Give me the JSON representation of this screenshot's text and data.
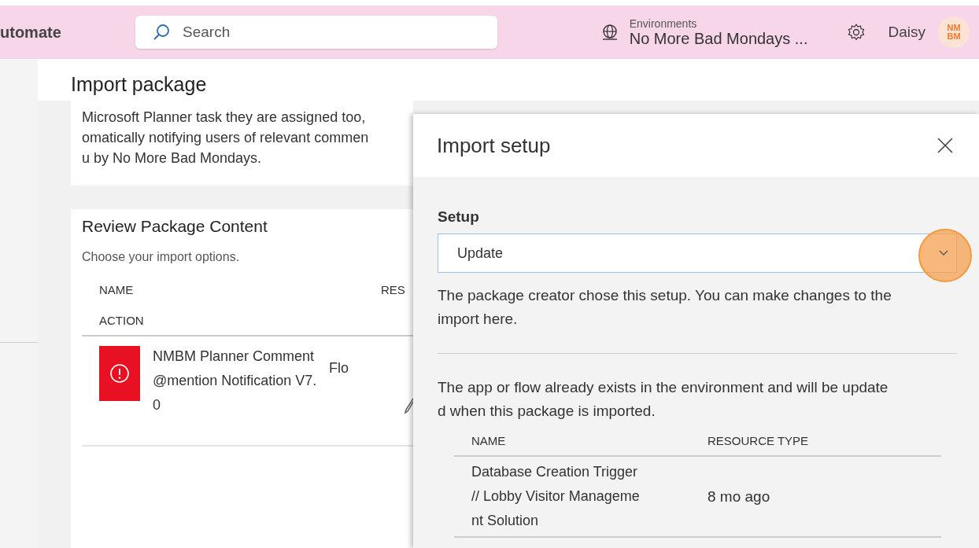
{
  "header": {
    "app_name": "utomate",
    "search": {
      "placeholder": "Search"
    },
    "environment": {
      "label": "Environments",
      "value": "No More Bad Mondays ..."
    },
    "user": {
      "name": "Daisy",
      "avatar": "NMBM"
    }
  },
  "page": {
    "title": "Import package",
    "description_lines": [
      "Microsoft Planner task they are assigned too,",
      "omatically notifying users of relevant commen",
      "u by No More Bad Mondays."
    ],
    "review": {
      "title": "Review Package Content",
      "subtitle": "Choose your import options.",
      "columns": [
        "NAME",
        "RES",
        "ACTION"
      ],
      "rows": [
        {
          "name": "NMBM Planner Comment @mention Notification V7.0",
          "type": "Flo",
          "kind": "error"
        }
      ]
    }
  },
  "panel": {
    "title": "Import setup",
    "setup_label": "Setup",
    "setup_value": "Update",
    "highlight": true,
    "note": "The package creator chose this setup. You can make changes to the import here.",
    "info": "The app or flow already exists in the environment and will be updated when this package is imported.",
    "columns": [
      "NAME",
      "RESOURCE TYPE"
    ],
    "rows": [
      {
        "name": "Database Creation Trigger // Lobby Visitor Management Solution",
        "type": "8 mo ago"
      }
    ]
  }
}
